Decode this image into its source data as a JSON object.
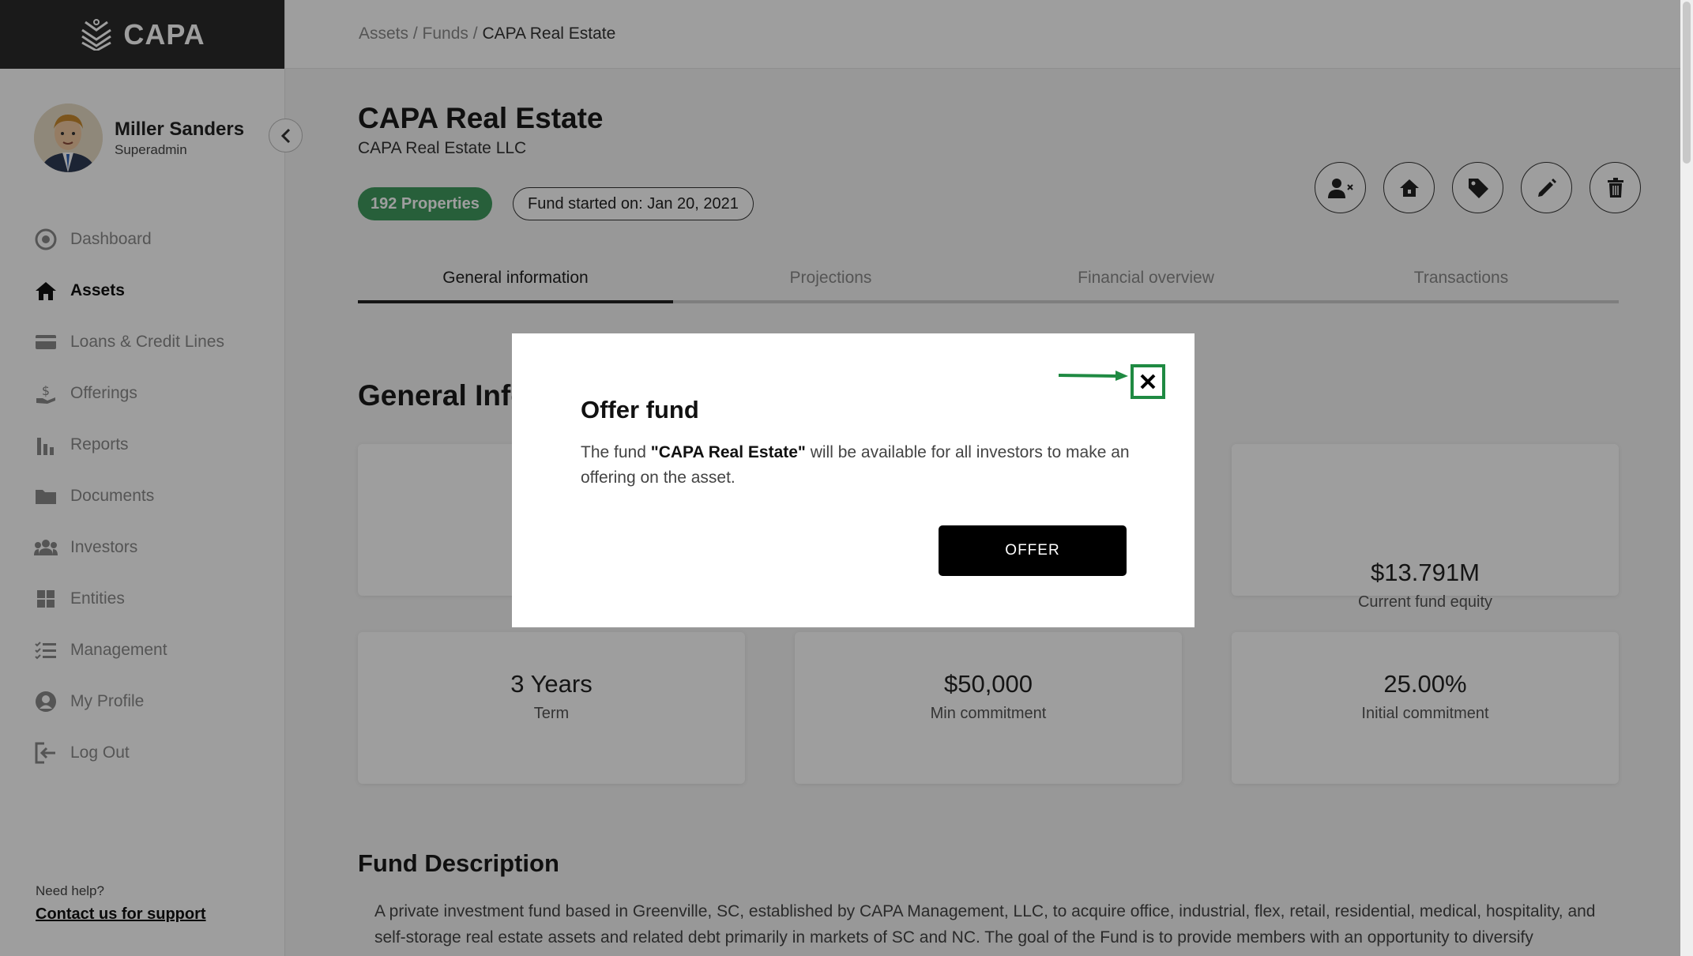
{
  "app": {
    "logo_text": "CAPA"
  },
  "user": {
    "name": "Miller Sanders",
    "role": "Superadmin"
  },
  "nav": {
    "items": [
      {
        "label": "Dashboard",
        "icon": "dashboard-icon"
      },
      {
        "label": "Assets",
        "icon": "home-icon",
        "active": true
      },
      {
        "label": "Loans & Credit Lines",
        "icon": "credit-card-icon"
      },
      {
        "label": "Offerings",
        "icon": "hand-money-icon"
      },
      {
        "label": "Reports",
        "icon": "bar-chart-icon"
      },
      {
        "label": "Documents",
        "icon": "folder-icon"
      },
      {
        "label": "Investors",
        "icon": "people-icon"
      },
      {
        "label": "Entities",
        "icon": "grid-icon"
      },
      {
        "label": "Management",
        "icon": "checklist-icon"
      },
      {
        "label": "My Profile",
        "icon": "profile-icon"
      },
      {
        "label": "Log Out",
        "icon": "logout-icon"
      }
    ]
  },
  "help": {
    "label": "Need help?",
    "link": "Contact us for support"
  },
  "breadcrumb": {
    "assets": "Assets /",
    "funds": "Funds /",
    "current": "CAPA Real Estate"
  },
  "fund": {
    "title": "CAPA Real Estate",
    "subtitle": "CAPA Real Estate LLC",
    "properties_badge": "192 Properties",
    "started_badge": "Fund started on: Jan 20, 2021"
  },
  "tabs": [
    "General information",
    "Projections",
    "Financial overview",
    "Transactions"
  ],
  "section_title": "General Information",
  "cards": {
    "equity": {
      "value": "$13.791M",
      "label": "Current fund equity"
    },
    "term": {
      "value": "3 Years",
      "label": "Term"
    },
    "min_commitment": {
      "value": "$50,000",
      "label": "Min commitment"
    },
    "initial_commitment": {
      "value": "25.00%",
      "label": "Initial commitment"
    }
  },
  "description": {
    "title": "Fund Description",
    "text": "A private investment fund based in Greenville, SC, established by CAPA Management, LLC, to acquire office, industrial, flex, retail, residential, medical, hospitality, and self-storage real estate assets and related debt primarily in markets of SC and NC. The goal of the Fund is to provide members with an opportunity to diversify"
  },
  "modal": {
    "title": "Offer fund",
    "body_prefix": "The fund ",
    "body_fund": "\"CAPA Real Estate\"",
    "body_suffix": " will be available for all investors to make an offering on the asset.",
    "offer_label": "OFFER"
  },
  "colors": {
    "accent_green": "#3f9a5e",
    "highlight_green": "#1f8a42",
    "dark": "#2b2b2b"
  }
}
